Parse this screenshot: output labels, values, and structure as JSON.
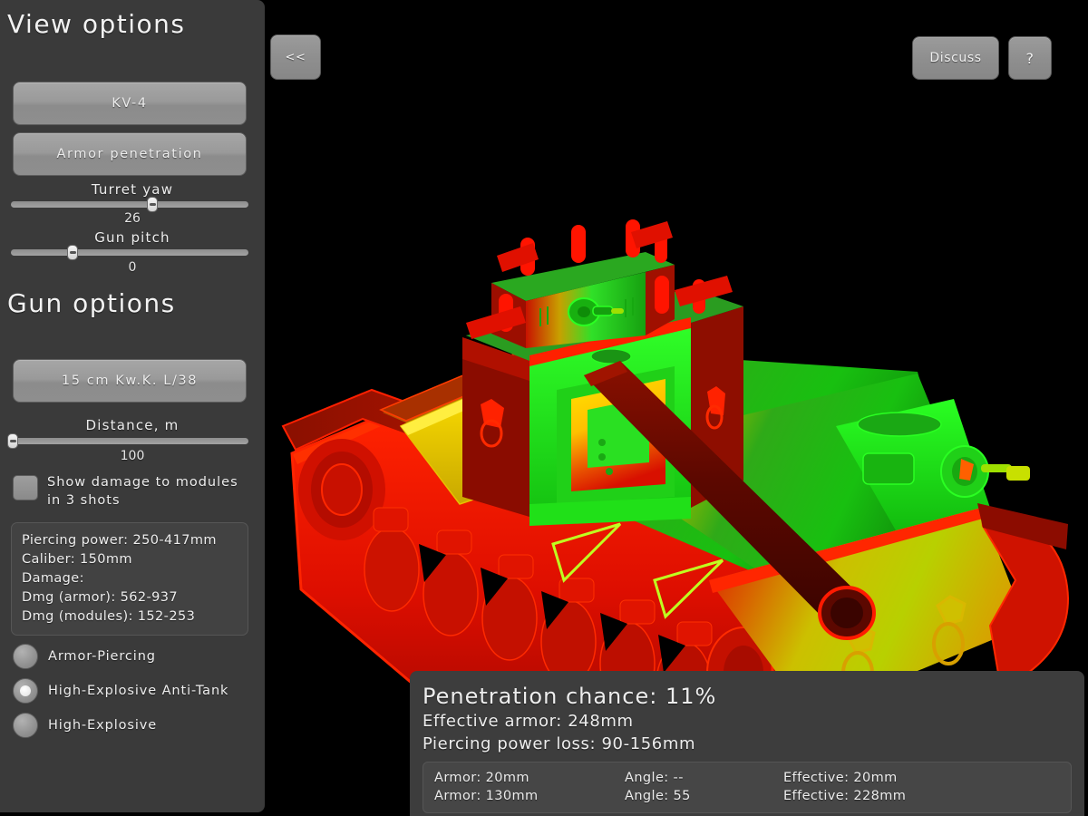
{
  "sidebar": {
    "view_options_title": "View options",
    "gun_options_title": "Gun options",
    "tank_button": "KV-4",
    "mode_button": "Armor penetration",
    "turret_yaw": {
      "label": "Turret yaw",
      "value": "26",
      "percent": 60
    },
    "gun_pitch": {
      "label": "Gun pitch",
      "value": "0",
      "percent": 25
    },
    "gun_button": "15 cm Kw.K. L/38",
    "distance": {
      "label": "Distance, m",
      "value": "100",
      "percent": 1
    },
    "show_damage_checkbox": {
      "label": "Show damage to modules in 3 shots",
      "checked": false
    },
    "stats": [
      "Piercing power: 250-417mm",
      "Caliber: 150mm",
      "Damage:",
      "Dmg (armor): 562-937",
      "Dmg (modules): 152-253"
    ],
    "shell_types": [
      {
        "label": "Armor-Piercing",
        "selected": false
      },
      {
        "label": "High-Explosive Anti-Tank",
        "selected": true
      },
      {
        "label": "High-Explosive",
        "selected": false
      }
    ]
  },
  "topbar": {
    "back_label": "<<",
    "discuss_label": "Discuss",
    "help_label": "?"
  },
  "info": {
    "penetration_chance": "Penetration chance: 11%",
    "effective_armor": "Effective armor: 248mm",
    "piercing_power_loss": "Piercing power loss: 90-156mm",
    "armor_rows": [
      {
        "armor": "Armor: 20mm",
        "angle": "Angle: --",
        "effective": "Effective: 20mm"
      },
      {
        "armor": "Armor: 130mm",
        "angle": "Angle: 55",
        "effective": "Effective: 228mm"
      }
    ]
  },
  "viewport": {
    "model_name": "KV-4 armor penetration heatmap",
    "background": "#000000",
    "palette": {
      "impenetrable": "#e00000",
      "hard": "#b01000",
      "medium": "#d8c800",
      "easy": "#10d810",
      "easiest": "#00ff00"
    }
  }
}
